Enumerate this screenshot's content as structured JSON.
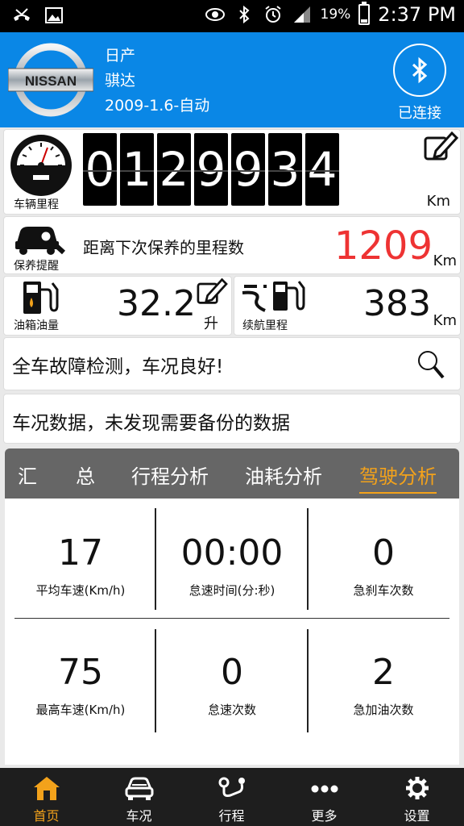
{
  "status_bar": {
    "battery_percent": "19%",
    "battery_level": 0.19,
    "time": "2:37 PM"
  },
  "header": {
    "logo_text": "NISSAN",
    "brand": "日产",
    "model": "骐达",
    "spec": "2009-1.6-自动",
    "bluetooth_status": "已连接"
  },
  "odometer": {
    "label": "车辆里程",
    "digits": [
      "0",
      "1",
      "2",
      "9",
      "9",
      "3",
      "4"
    ],
    "unit": "Km"
  },
  "maintenance": {
    "label": "保养提醒",
    "title": "距离下次保养的里程数",
    "value": "1209",
    "unit": "Km"
  },
  "fuel": {
    "label": "油箱油量",
    "value": "32.2",
    "unit": "升"
  },
  "range": {
    "label": "续航里程",
    "value": "383",
    "unit": "Km"
  },
  "diagnosis": {
    "text": "全车故障检测，车况良好!"
  },
  "backup": {
    "text": "车况数据，未发现需要备份的数据"
  },
  "tabs": [
    {
      "label": "汇　　总"
    },
    {
      "label": "行程分析"
    },
    {
      "label": "油耗分析"
    },
    {
      "label": "驾驶分析",
      "active": true
    }
  ],
  "stats": [
    {
      "value": "17",
      "label": "平均车速(Km/h)"
    },
    {
      "value": "00:00",
      "label": "怠速时间(分:秒)"
    },
    {
      "value": "0",
      "label": "急刹车次数"
    },
    {
      "value": "75",
      "label": "最高车速(Km/h)"
    },
    {
      "value": "0",
      "label": "怠速次数"
    },
    {
      "value": "2",
      "label": "急加油次数"
    }
  ],
  "nav": [
    {
      "label": "首页",
      "icon": "home-icon",
      "active": true
    },
    {
      "label": "车况",
      "icon": "car-icon"
    },
    {
      "label": "行程",
      "icon": "route-icon"
    },
    {
      "label": "更多",
      "icon": "more-icon"
    },
    {
      "label": "设置",
      "icon": "gear-icon"
    }
  ],
  "colors": {
    "header_blue": "#0a87e6",
    "accent_orange": "#f3a21b",
    "alert_red": "#e33"
  }
}
